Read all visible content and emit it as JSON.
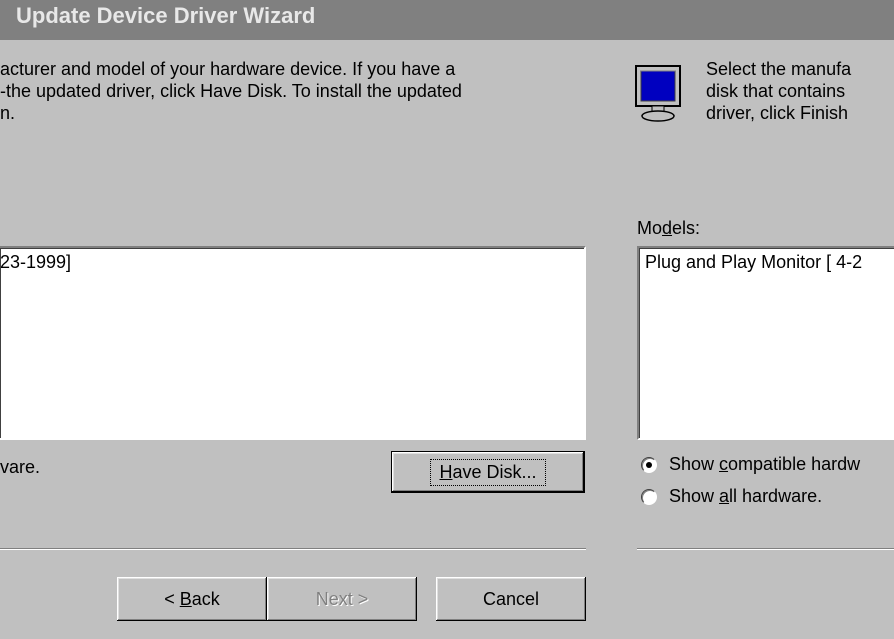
{
  "window": {
    "title": "Update Device Driver Wizard"
  },
  "description": {
    "left_lines": [
      "acturer and model of your hardware device. If you have a",
      "-the updated driver, click Have Disk. To install the updated",
      "n."
    ],
    "right_lines": [
      "Select the manufa",
      "disk that contains",
      "driver, click Finish"
    ],
    "icon": "monitor-icon"
  },
  "left_list": {
    "items": [
      "23-1999]"
    ]
  },
  "models": {
    "label_pre": "Mo",
    "label_accel": "d",
    "label_post": "els:",
    "items": [
      "Plug and Play Monitor [ 4-2"
    ]
  },
  "left_option_fragment": "vare.",
  "have_disk": {
    "accel": "H",
    "rest": "ave Disk..."
  },
  "radios": [
    {
      "pre": "Show ",
      "accel": "c",
      "post": "ompatible hardw",
      "checked": true
    },
    {
      "pre": "Show ",
      "accel": "a",
      "post": "ll hardware.",
      "checked": false
    }
  ],
  "buttons": {
    "back": {
      "pre": "< ",
      "accel": "B",
      "post": "ack"
    },
    "next": "Next >",
    "cancel": "Cancel"
  },
  "colors": {
    "face": "#c0c0c0",
    "titlebar": "#808080",
    "list_bg": "#ffffff",
    "screen_blue": "#0000c0"
  }
}
